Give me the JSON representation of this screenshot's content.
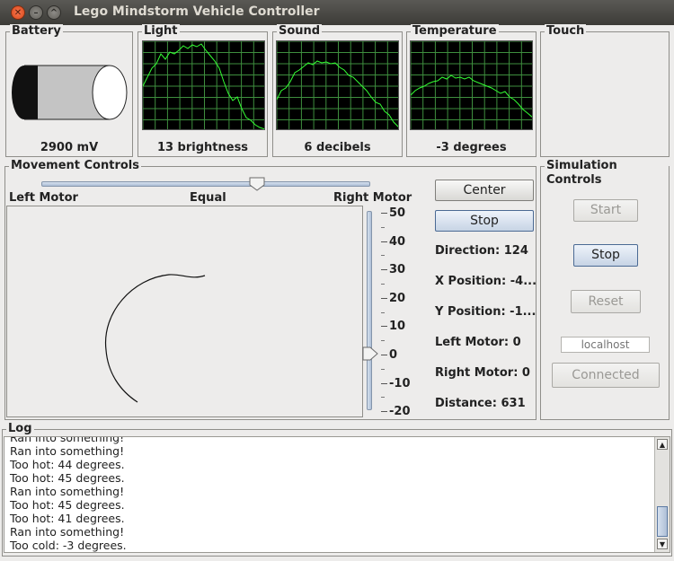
{
  "window": {
    "title": "Lego Mindstorm Vehicle Controller"
  },
  "battery": {
    "title": "Battery",
    "value": "2900 mV"
  },
  "light": {
    "title": "Light",
    "value": "13 brightness"
  },
  "sound": {
    "title": "Sound",
    "value": "6 decibels"
  },
  "temperature": {
    "title": "Temperature",
    "value": "-3 degrees"
  },
  "touch": {
    "title": "Touch"
  },
  "movement": {
    "title": "Movement Controls",
    "left_label": "Left Motor",
    "center_label": "Equal",
    "right_label": "Right Motor",
    "center_button": "Center",
    "stop_button": "Stop",
    "slider_ticks": [
      "50",
      "40",
      "30",
      "20",
      "10",
      "0",
      "-10",
      "-20"
    ],
    "direction": "Direction: 124",
    "x_position": "X Position: -4...",
    "y_position": "Y Position: -1...",
    "left_motor": "Left Motor: 0",
    "right_motor": "Right Motor: 0",
    "distance": "Distance: 631"
  },
  "simulation": {
    "title": "Simulation Controls",
    "start_button": "Start",
    "stop_button": "Stop",
    "reset_button": "Reset",
    "host_placeholder": "localhost",
    "connected_button": "Connected"
  },
  "log": {
    "title": "Log",
    "lines": [
      "Ran into something!",
      "Ran into something!",
      "Too hot:  44 degrees.",
      "Too hot:  45 degrees.",
      "Ran into something!",
      "Too hot:  45 degrees.",
      "Too hot:  41 degrees.",
      "Ran into something!",
      "Too cold:  -3 degrees."
    ]
  },
  "colors": {
    "scope_bg": "#000000",
    "scope_grid": "#3e8e3e",
    "scope_trace": "#33ff33"
  }
}
